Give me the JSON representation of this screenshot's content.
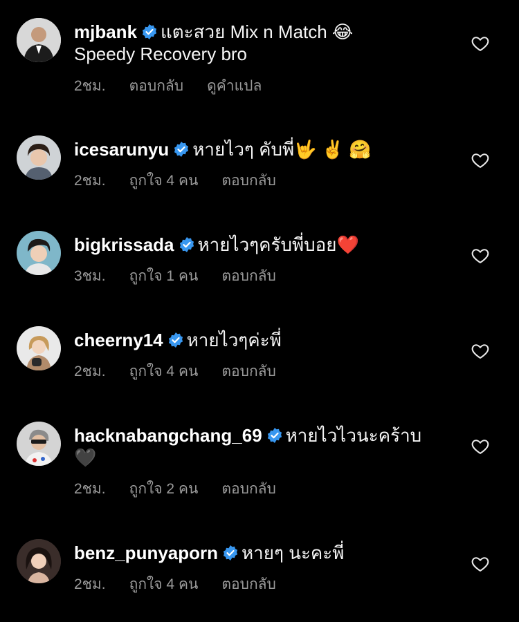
{
  "comments": [
    {
      "username": "mjbank",
      "verified": true,
      "text": "แตะสวย Mix n Match 😂",
      "text_line2": "Speedy Recovery bro",
      "time": "2ชม.",
      "likes": "",
      "reply": "ตอบกลับ",
      "see_translation": "ดูคำแปล"
    },
    {
      "username": "icesarunyu",
      "verified": true,
      "text": "หายไวๆ คับพี่🤟 ✌️ 🤗",
      "time": "2ชม.",
      "likes": "ถูกใจ 4 คน",
      "reply": "ตอบกลับ"
    },
    {
      "username": "bigkrissada",
      "verified": true,
      "text": "หายไวๆครับพี่บอย❤️",
      "time": "3ชม.",
      "likes": "ถูกใจ 1 คน",
      "reply": "ตอบกลับ"
    },
    {
      "username": "cheerny14",
      "verified": true,
      "text": "หายไวๆค่ะพี่",
      "time": "2ชม.",
      "likes": "ถูกใจ 4 คน",
      "reply": "ตอบกลับ"
    },
    {
      "username": "hacknabangchang_69",
      "verified": true,
      "text": "หายไวไวนะคร้าบ",
      "text_line2": "🖤",
      "time": "2ชม.",
      "likes": "ถูกใจ 2 คน",
      "reply": "ตอบกลับ"
    },
    {
      "username": "benz_punyaporn",
      "verified": true,
      "text": "หายๆ นะคะพี่",
      "time": "2ชม.",
      "likes": "ถูกใจ 4 คน",
      "reply": "ตอบกลับ"
    }
  ],
  "icons": {
    "verified": "verified-badge-icon",
    "like": "heart-outline-icon"
  },
  "colors": {
    "background": "#000000",
    "text": "#ffffff",
    "meta": "#9a9a9a",
    "verified": "#3897f0"
  }
}
